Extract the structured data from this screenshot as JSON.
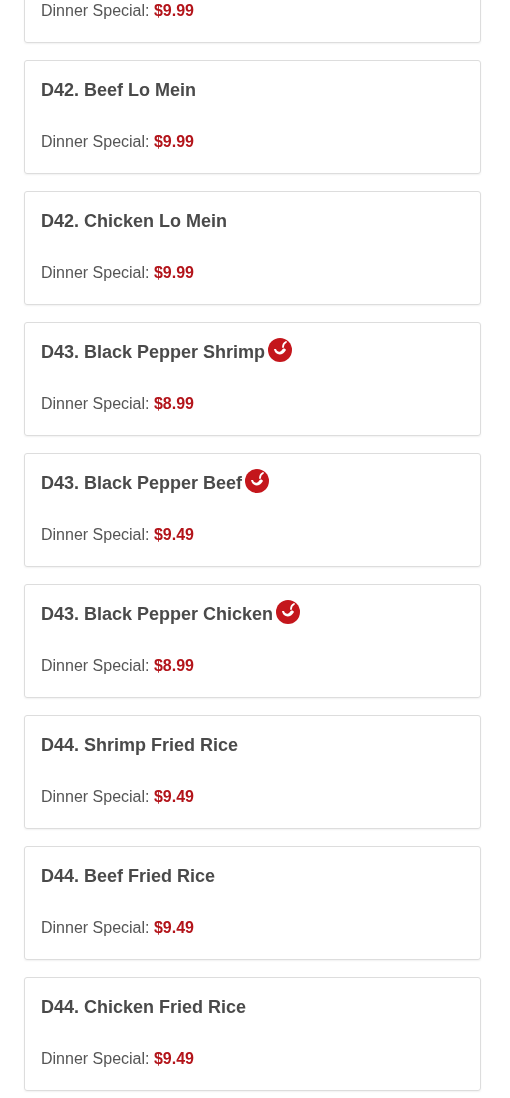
{
  "menu_items": [
    {
      "kind": "partial",
      "price_label": "Dinner Special:",
      "price": "$9.99"
    },
    {
      "kind": "full",
      "name": "D42. Beef Lo Mein",
      "spicy": false,
      "price_label": "Dinner Special:",
      "price": "$9.99"
    },
    {
      "kind": "full",
      "name": "D42. Chicken Lo Mein",
      "spicy": false,
      "price_label": "Dinner Special:",
      "price": "$9.99"
    },
    {
      "kind": "full",
      "name": "D43. Black Pepper Shrimp",
      "spicy": true,
      "price_label": "Dinner Special:",
      "price": "$8.99"
    },
    {
      "kind": "full",
      "name": "D43. Black Pepper Beef",
      "spicy": true,
      "price_label": "Dinner Special:",
      "price": "$9.49"
    },
    {
      "kind": "full",
      "name": "D43. Black Pepper Chicken",
      "spicy": true,
      "price_label": "Dinner Special:",
      "price": "$8.99"
    },
    {
      "kind": "full",
      "name": "D44. Shrimp Fried Rice",
      "spicy": false,
      "price_label": "Dinner Special:",
      "price": "$9.49"
    },
    {
      "kind": "full",
      "name": "D44. Beef Fried Rice",
      "spicy": false,
      "price_label": "Dinner Special:",
      "price": "$9.49"
    },
    {
      "kind": "full",
      "name": "D44. Chicken Fried Rice",
      "spicy": false,
      "price_label": "Dinner Special:",
      "price": "$9.49"
    }
  ]
}
